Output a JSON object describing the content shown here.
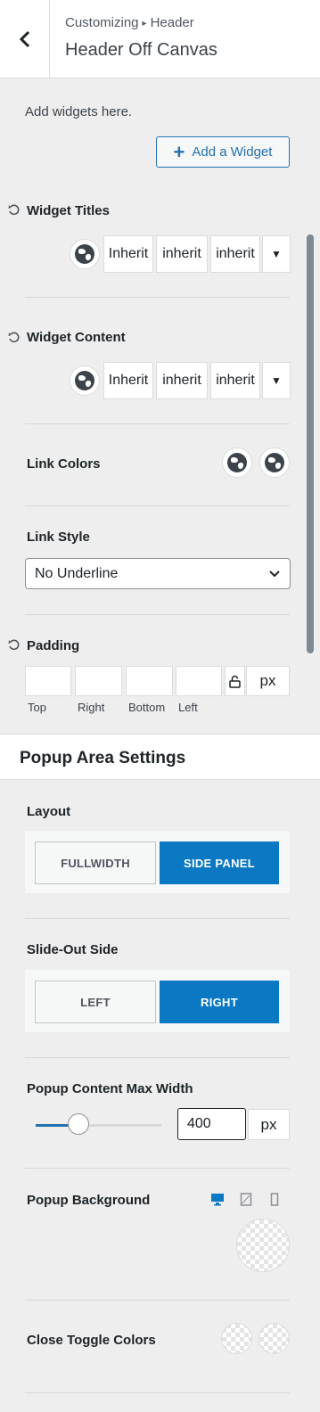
{
  "header": {
    "breadcrumb_root": "Customizing",
    "breadcrumb_sep": "▸",
    "breadcrumb_section": "Header",
    "title": "Header Off Canvas"
  },
  "widgets": {
    "hint": "Add widgets here.",
    "add_button": "Add a Widget"
  },
  "widget_titles": {
    "label": "Widget Titles",
    "family": "Inherit",
    "weight": "inherit",
    "style": "inherit"
  },
  "widget_content": {
    "label": "Widget Content",
    "family": "Inherit",
    "weight": "inherit",
    "style": "inherit"
  },
  "link_colors": {
    "label": "Link Colors"
  },
  "link_style": {
    "label": "Link Style",
    "value": "No Underline"
  },
  "padding": {
    "label": "Padding",
    "top": "Top",
    "right": "Right",
    "bottom": "Bottom",
    "left": "Left",
    "unit": "px"
  },
  "popup_section": {
    "title": "Popup Area Settings"
  },
  "layout": {
    "label": "Layout",
    "options": [
      "FULLWIDTH",
      "SIDE PANEL"
    ],
    "selected": "SIDE PANEL"
  },
  "slide_out": {
    "label": "Slide-Out Side",
    "options": [
      "LEFT",
      "RIGHT"
    ],
    "selected": "RIGHT"
  },
  "max_width": {
    "label": "Popup Content Max Width",
    "value": "400",
    "unit": "px"
  },
  "popup_background": {
    "label": "Popup Background"
  },
  "close_toggle": {
    "label": "Close Toggle Colors"
  },
  "icons": {
    "back": "chevron-left-icon",
    "reset": "reset-icon",
    "global": "globe-icon",
    "dropdown": "caret-down-icon",
    "lock": "unlock-icon",
    "desktop": "desktop-icon",
    "tablet": "tablet-icon",
    "mobile": "mobile-icon"
  },
  "colors": {
    "accent": "#0a78c2",
    "link": "#2271b1"
  }
}
